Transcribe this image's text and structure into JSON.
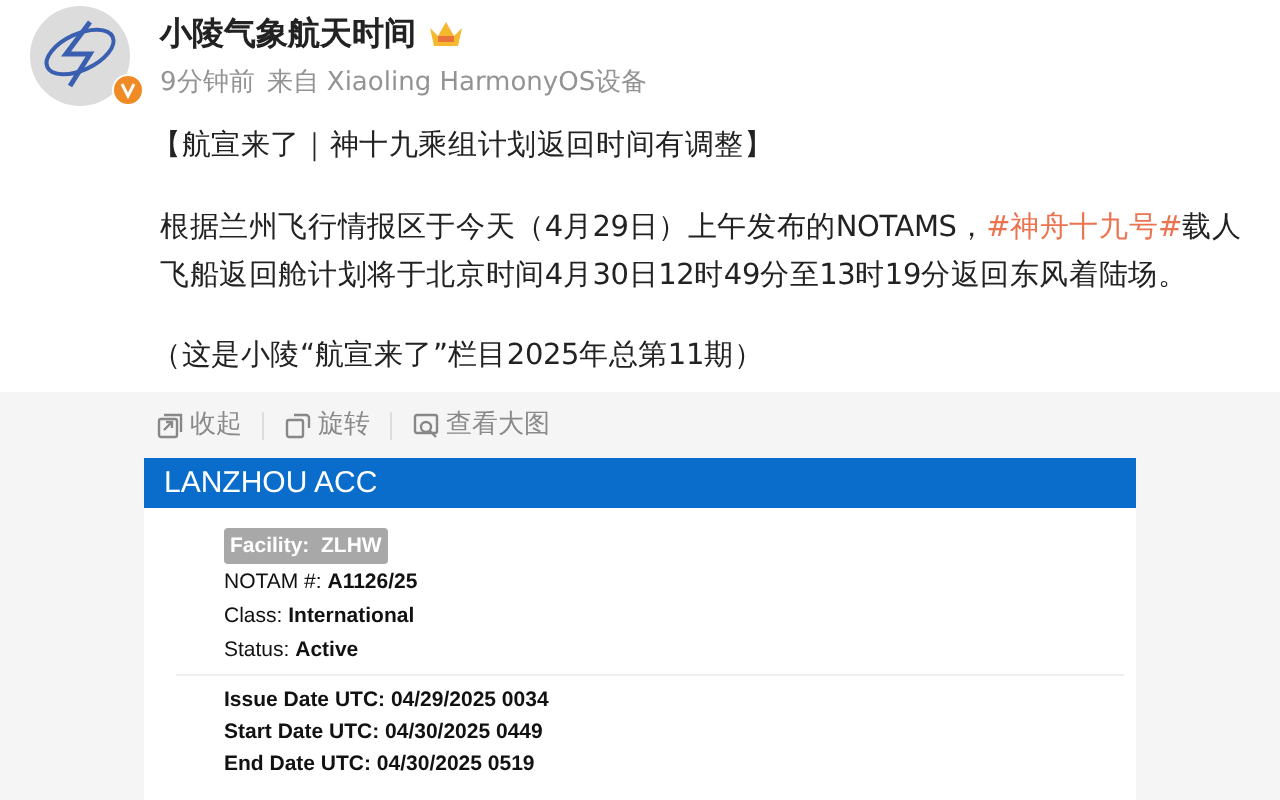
{
  "author": {
    "name": "小陵气象航天时间",
    "time": "9分钟前",
    "source": "来自 Xiaoling HarmonyOS设备"
  },
  "post": {
    "title": "【航宣来了｜神十九乘组计划返回时间有调整】",
    "body": [
      {
        "kind": "plain",
        "text": "根据兰州飞行情报区于今天（4月29日）上午发布的NOTAMS，"
      },
      {
        "kind": "hashtag",
        "text": "#神舟十九号#"
      },
      {
        "kind": "plain",
        "text": "载人飞船返回舱计划将于北京时间4月30日12时49分至13时19分返回东风着陆场。"
      }
    ],
    "note": "（这是小陵“航宣来了”栏目2025年总第11期）"
  },
  "image_actions": [
    {
      "kind": "collapse",
      "label": "收起"
    },
    {
      "kind": "rotate",
      "label": "旋转"
    },
    {
      "kind": "zoom",
      "label": "查看大图"
    }
  ],
  "notam": {
    "header": "LANZHOU ACC",
    "facility": "Facility:  ZLHW",
    "fields": [
      {
        "label": "NOTAM #:",
        "value": "A1126/25"
      },
      {
        "label": "Class:",
        "value": "International"
      },
      {
        "label": "Status:",
        "value": "Active"
      }
    ],
    "dates": [
      {
        "label": "Issue Date UTC:",
        "value": "04/29/2025 0034"
      },
      {
        "label": "Start Date UTC:",
        "value": "04/30/2025 0449"
      },
      {
        "label": "End Date UTC:",
        "value": "04/30/2025 0519"
      }
    ]
  }
}
